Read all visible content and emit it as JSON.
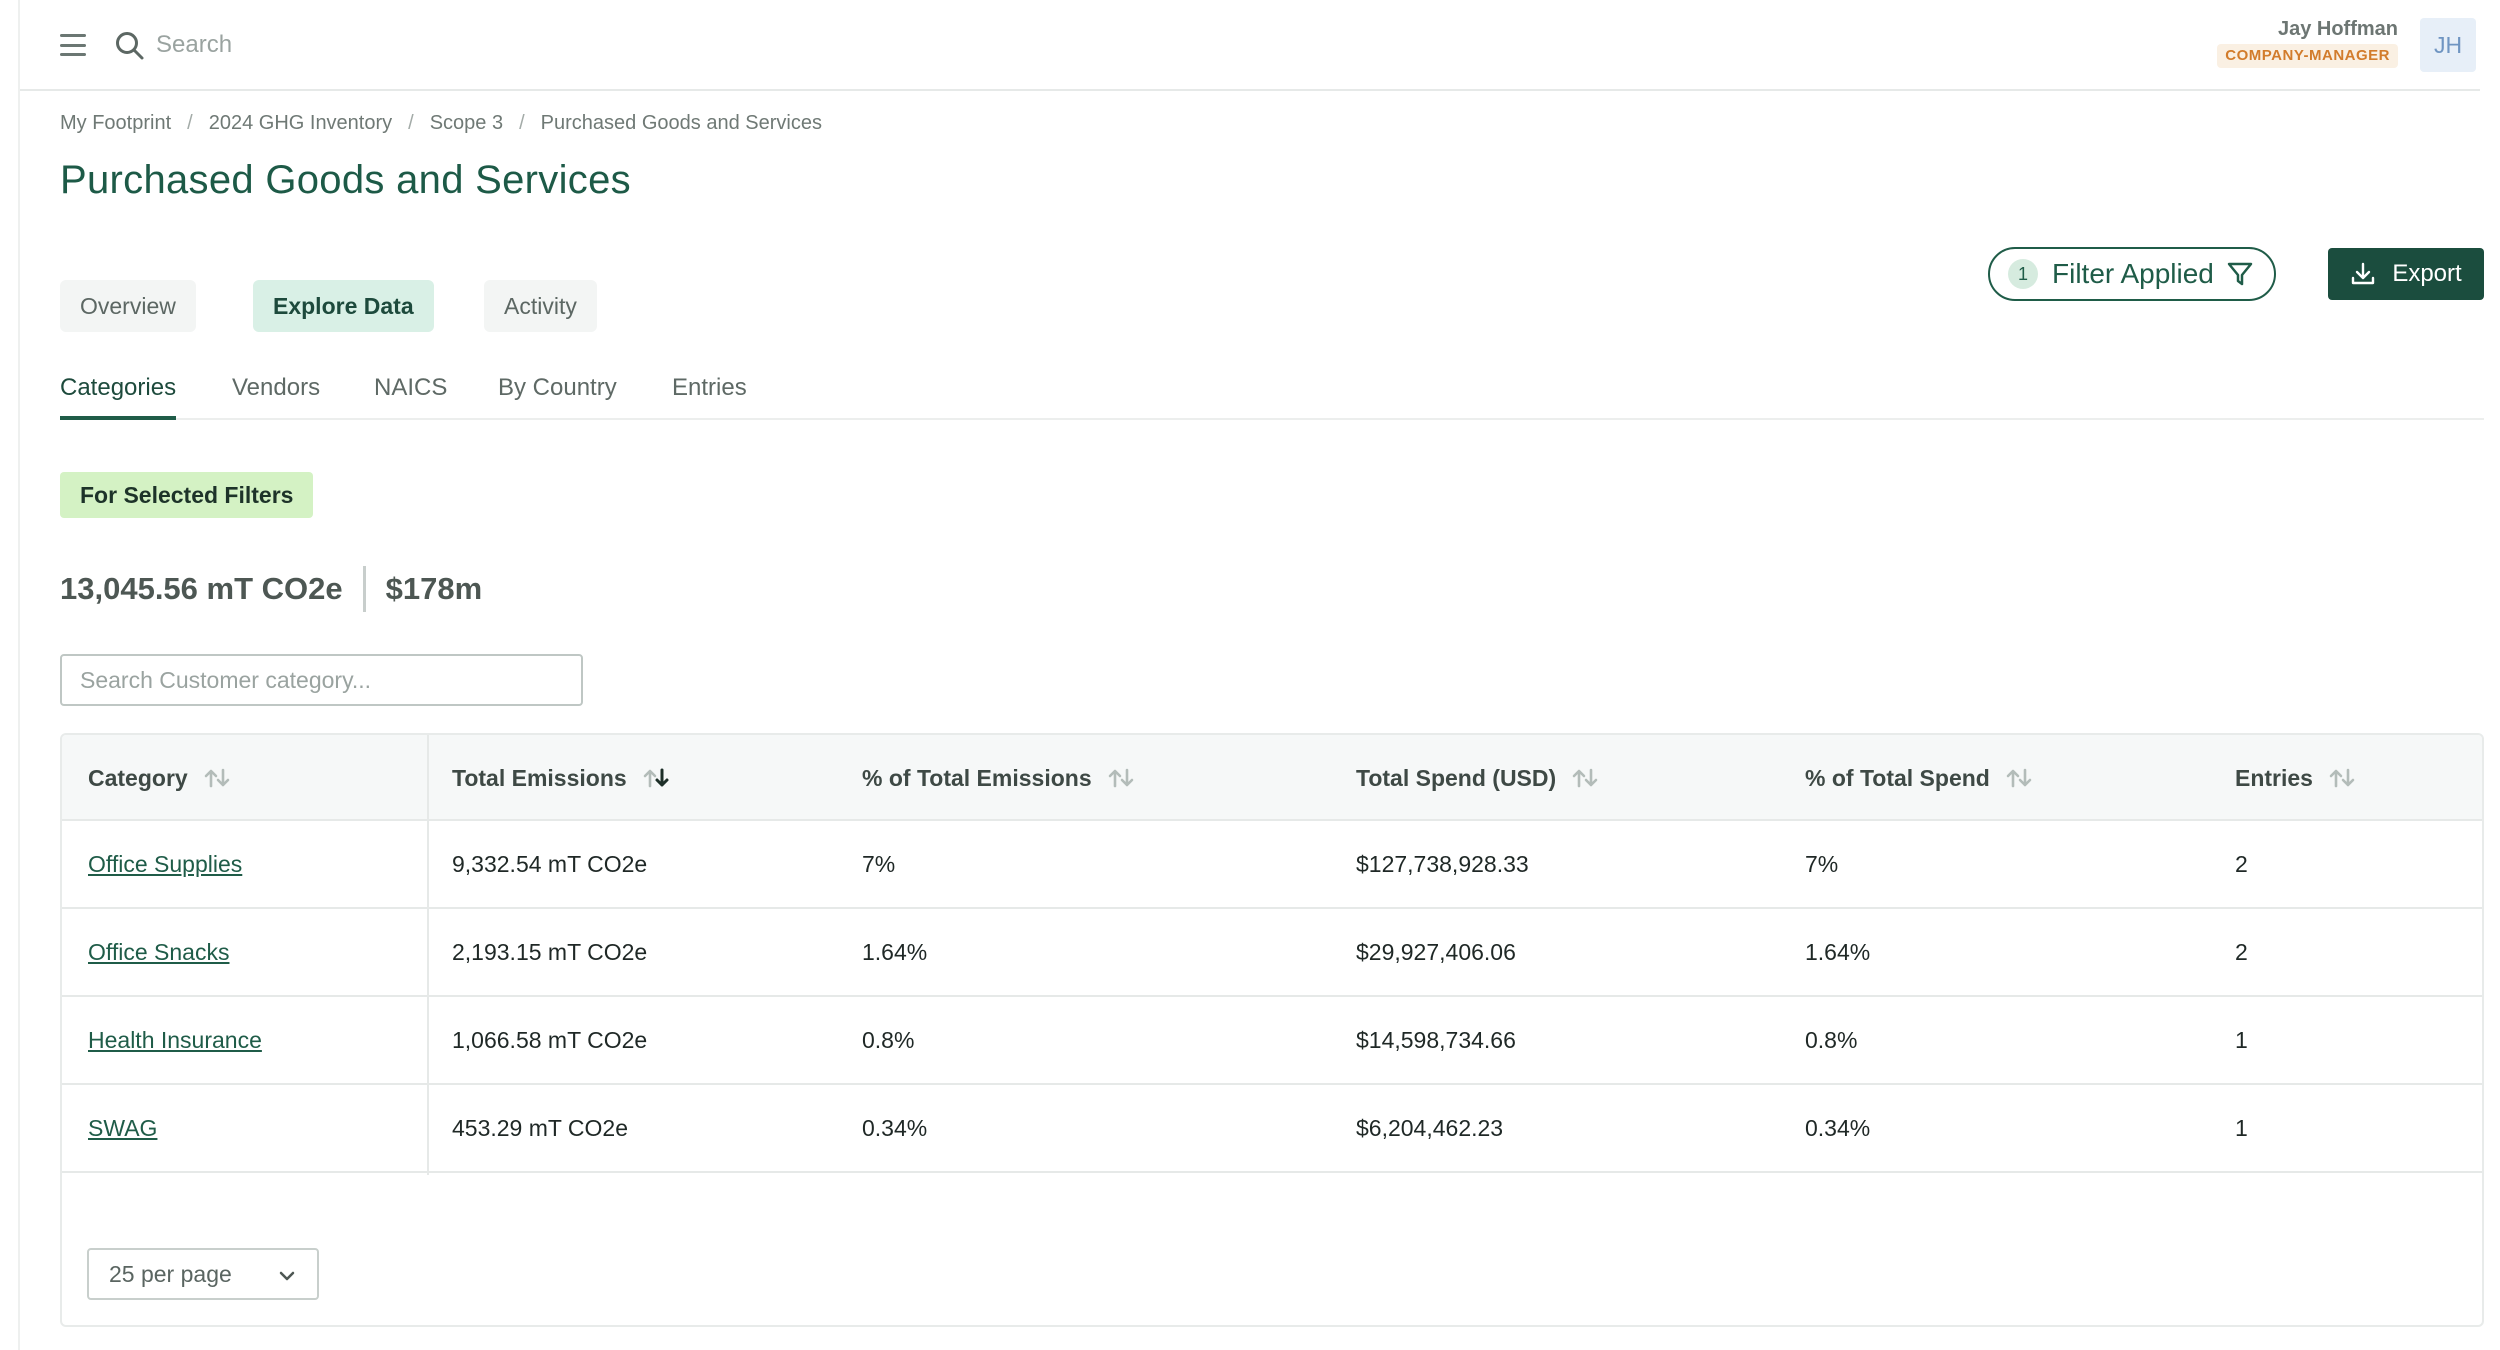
{
  "topbar": {
    "search_placeholder": "Search",
    "user_name": "Jay Hoffman",
    "user_role": "COMPANY-MANAGER",
    "avatar_initials": "JH"
  },
  "breadcrumb": [
    "My Footprint",
    "2024 GHG Inventory",
    "Scope 3",
    "Purchased Goods and Services"
  ],
  "page_title": "Purchased Goods and Services",
  "view_tabs": [
    "Overview",
    "Explore Data",
    "Activity"
  ],
  "active_view_tab": "Explore Data",
  "filter": {
    "count": "1",
    "label": "Filter Applied"
  },
  "export_label": "Export",
  "sub_tabs": [
    "Categories",
    "Vendors",
    "NAICS",
    "By Country",
    "Entries"
  ],
  "active_sub_tab": "Categories",
  "summary": {
    "badge": "For Selected Filters",
    "emissions": "13,045.56 mT CO2e",
    "spend": "$178m"
  },
  "category_search": {
    "placeholder": "Search Customer category..."
  },
  "table": {
    "columns": [
      "Category",
      "Total Emissions",
      "% of Total Emissions",
      "Total Spend (USD)",
      "% of Total Spend",
      "Entries"
    ],
    "sorted_column": "Total Emissions",
    "rows": [
      [
        "Office Supplies",
        "9,332.54 mT CO2e",
        "7%",
        "$127,738,928.33",
        "7%",
        "2"
      ],
      [
        "Office Snacks",
        "2,193.15 mT CO2e",
        "1.64%",
        "$29,927,406.06",
        "1.64%",
        "2"
      ],
      [
        "Health Insurance",
        "1,066.58 mT CO2e",
        "0.8%",
        "$14,598,734.66",
        "0.8%",
        "1"
      ],
      [
        "SWAG",
        "453.29 mT CO2e",
        "0.34%",
        "$6,204,462.23",
        "0.34%",
        "1"
      ]
    ]
  },
  "per_page": "25 per page",
  "colors": {
    "brand_dark": "#1b4d3e",
    "brand_text": "#1d5a47",
    "active_tab_bg": "#d9f0e6",
    "badge_bg": "#d4f2c4",
    "role_badge": "#d27c2c"
  },
  "icons": {
    "menu": "hamburger-icon",
    "search": "search-icon",
    "filter": "funnel-icon",
    "export": "download-icon",
    "sort": "sort-arrows-icon",
    "sort_desc": "sort-descending-icon",
    "dropdown": "chevron-down-icon"
  }
}
